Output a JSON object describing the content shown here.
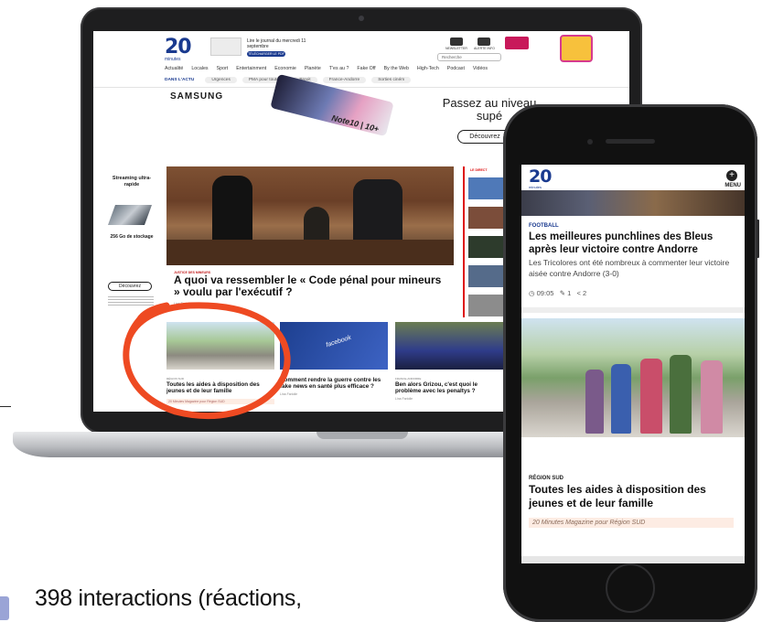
{
  "laptop_site": {
    "logo": "20",
    "logo_sub": "minutes",
    "promo_text": "Lire le journal du mercredi 11 septembre",
    "promo_button": "TÉLÉCHARGER LE PDF",
    "header_icons": [
      "NEWSLETTER",
      "ALERTE INFO"
    ],
    "search_placeholder": "Recherche",
    "nav": [
      "Actualité",
      "Locales",
      "Sport",
      "Entertainment",
      "Economie",
      "Planète",
      "T'es au ?",
      "Fake Off",
      "By the Web",
      "High-Tech",
      "Podcast",
      "Vidéos"
    ],
    "subnav_label": "DANS L'ACTU",
    "subnav": [
      "Urgences",
      "PMA pour toutes",
      "Brexit",
      "France-Andorre",
      "Sorties ciném"
    ],
    "ad": {
      "brand": "SAMSUNG",
      "product": "Note10 | 10+",
      "headline": "Passez au niveau supé",
      "button": "Découvrez"
    },
    "side_ad": {
      "title": "Streaming ultra-rapide",
      "storage": "256 Go de stockage",
      "button": "Découvrez"
    },
    "hero": {
      "tag": "JUSTICE DES MINEURS",
      "title": "A quoi va ressembler le « Code pénal pour mineurs » voulu par l'exécutif ?",
      "author": "Lina Fariolle"
    },
    "live_label": "LE DIRECT",
    "cards": [
      {
        "tag": "RÉGION SUD",
        "title": "Toutes les aides à disposition des jeunes et de leur famille",
        "magazine": "20 Minutes Magazine pour Région SUD"
      },
      {
        "tag": "",
        "title": "Comment rendre la guerre contre les fake news en santé plus efficace ?",
        "author": "Lina Fariolle",
        "img_word": "facebook"
      },
      {
        "tag": "FRANCE-ANDORRE",
        "title": "Ben alors Grizou, c'est quoi le problème avec les penaltys ?",
        "author": "Lina Fariolle"
      }
    ]
  },
  "phone_site": {
    "logo": "20",
    "logo_sub": "minutes",
    "menu_label": "MENU",
    "article1": {
      "category": "FOOTBALL",
      "title": "Les meilleures punchlines des Bleus après leur victoire contre Andorre",
      "description": "Les Tricolores ont été nombreux à commenter leur victoire aisée contre Andorre (3-0)",
      "time": "09:05",
      "comments": "1",
      "shares": "2"
    },
    "article2": {
      "category": "RÉGION SUD",
      "title": "Toutes les aides à disposition des jeunes et de leur famille",
      "magazine": "20 Minutes Magazine pour Région SUD"
    }
  },
  "caption": {
    "bold": "398 interactions",
    "rest": "(réactions,"
  },
  "colors": {
    "brand_blue": "#1a3a8f",
    "highlight_red": "#ee4a22",
    "device_black": "#111111"
  }
}
